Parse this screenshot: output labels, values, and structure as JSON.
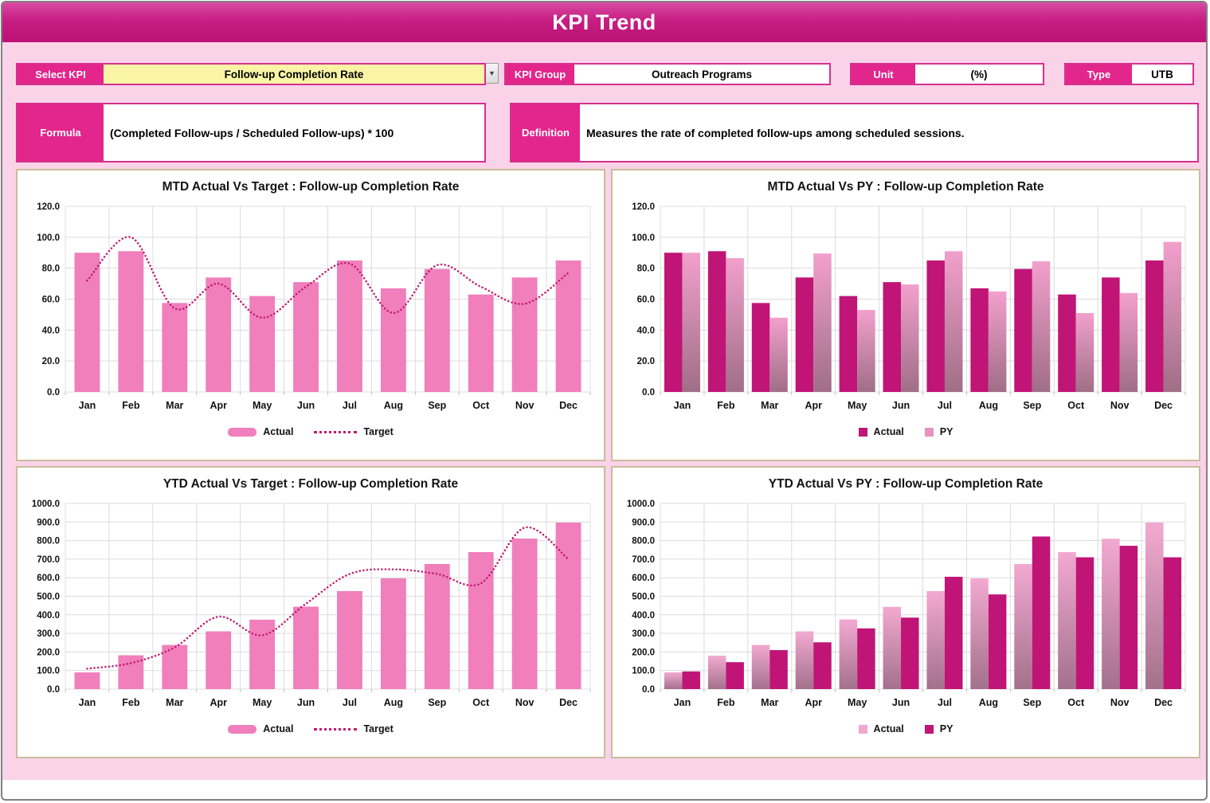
{
  "window": {
    "title": "KPI Trend"
  },
  "controls": {
    "select_kpi": {
      "label": "Select KPI",
      "value": "Follow-up Completion Rate",
      "dropdown_icon": "▼"
    },
    "kpi_group": {
      "label": "KPI Group",
      "value": "Outreach Programs"
    },
    "unit": {
      "label": "Unit",
      "value": "(%)"
    },
    "type": {
      "label": "Type",
      "value": "UTB"
    },
    "formula": {
      "label": "Formula",
      "value": "(Completed Follow-ups / Scheduled Follow-ups) * 100"
    },
    "definition": {
      "label": "Definition",
      "value": "Measures the rate of completed follow-ups among scheduled sessions."
    }
  },
  "colors": {
    "accent_magenta": "#E2268B",
    "titlebar_top": "#D84BA3",
    "titlebar_bottom": "#BB1174",
    "page_pink": "#FAD3E9",
    "panel_border_tan": "#C9BD9B",
    "bar_pink": "#F07FBB",
    "bar_dark_magenta": "#C01476",
    "gradient_bar_top": "#F2A0CC",
    "gradient_bar_bottom": "#A06E87",
    "target_dotted_line": "#C2186F",
    "gridline_gray": "#DCDCDC",
    "select_yellow": "#FAF5A6"
  },
  "chart_data": [
    {
      "type": "bar",
      "title": "MTD Actual Vs Target : Follow-up Completion Rate",
      "categories": [
        "Jan",
        "Feb",
        "Mar",
        "Apr",
        "May",
        "Jun",
        "Jul",
        "Aug",
        "Sep",
        "Oct",
        "Nov",
        "Dec"
      ],
      "ylim": [
        0,
        120
      ],
      "ytick": 20,
      "grid": true,
      "legend_position": "bottom",
      "series": [
        {
          "name": "Actual",
          "type": "bar",
          "color": "#F07FBB",
          "swatch": "bar",
          "legend_color": "#F07FBB",
          "values": [
            90,
            91,
            57.5,
            74,
            62,
            71,
            85,
            67,
            79.5,
            63,
            74,
            85
          ]
        },
        {
          "name": "Target",
          "type": "dotted-line",
          "color": "#C2186F",
          "swatch": "dots",
          "legend_color": "#C2186F",
          "values": [
            72,
            100,
            54,
            70,
            48,
            68,
            83,
            51,
            82,
            68,
            57,
            77
          ]
        }
      ]
    },
    {
      "type": "grouped-bar",
      "title": "MTD Actual Vs PY : Follow-up Completion Rate",
      "categories": [
        "Jan",
        "Feb",
        "Mar",
        "Apr",
        "May",
        "Jun",
        "Jul",
        "Aug",
        "Sep",
        "Oct",
        "Nov",
        "Dec"
      ],
      "ylim": [
        0,
        120
      ],
      "ytick": 20,
      "grid": true,
      "legend_position": "bottom",
      "series": [
        {
          "name": "Actual",
          "type": "bar",
          "color": "#C01476",
          "swatch": "square",
          "legend_color": "#C01476",
          "values": [
            90,
            91,
            57.5,
            74,
            62,
            71,
            85,
            67,
            79.5,
            63,
            74,
            85
          ]
        },
        {
          "name": "PY",
          "type": "bar",
          "gradient": [
            "#F2A0CC",
            "#A06E87"
          ],
          "swatch": "square",
          "legend_color": "#E793C0",
          "values": [
            90,
            86.5,
            48,
            89.5,
            53,
            69.5,
            91,
            65,
            84.5,
            51,
            64,
            97
          ]
        }
      ]
    },
    {
      "type": "bar",
      "title": "YTD Actual Vs Target : Follow-up Completion Rate",
      "categories": [
        "Jan",
        "Feb",
        "Mar",
        "Apr",
        "May",
        "Jun",
        "Jul",
        "Aug",
        "Sep",
        "Oct",
        "Nov",
        "Dec"
      ],
      "ylim": [
        0,
        1000
      ],
      "ytick": 100,
      "grid": true,
      "legend_position": "bottom",
      "series": [
        {
          "name": "Actual",
          "type": "bar",
          "color": "#F07FBB",
          "swatch": "bar",
          "legend_color": "#F07FBB",
          "values": [
            90,
            182,
            238,
            311,
            374,
            444,
            528,
            597,
            674,
            738,
            811,
            897
          ]
        },
        {
          "name": "Target",
          "type": "dotted-line",
          "color": "#C2186F",
          "swatch": "dots",
          "legend_color": "#C2186F",
          "values": [
            110,
            140,
            225,
            390,
            290,
            460,
            620,
            645,
            620,
            570,
            870,
            700
          ]
        }
      ]
    },
    {
      "type": "grouped-bar",
      "title": "YTD Actual Vs PY : Follow-up Completion Rate",
      "categories": [
        "Jan",
        "Feb",
        "Mar",
        "Apr",
        "May",
        "Jun",
        "Jul",
        "Aug",
        "Sep",
        "Oct",
        "Nov",
        "Dec"
      ],
      "ylim": [
        0,
        1000
      ],
      "ytick": 100,
      "grid": true,
      "legend_position": "bottom",
      "series": [
        {
          "name": "Actual",
          "type": "bar",
          "gradient": [
            "#F3A9D1",
            "#A3718C"
          ],
          "swatch": "square",
          "legend_color": "#EFA6CF",
          "values": [
            90,
            180,
            238,
            311,
            375,
            443,
            528,
            596,
            674,
            738,
            810,
            897
          ]
        },
        {
          "name": "PY",
          "type": "bar",
          "color": "#C01476",
          "swatch": "square",
          "legend_color": "#C01476",
          "values": [
            95,
            145,
            210,
            252,
            327,
            385,
            605,
            510,
            822,
            710,
            772,
            710
          ]
        }
      ]
    }
  ]
}
